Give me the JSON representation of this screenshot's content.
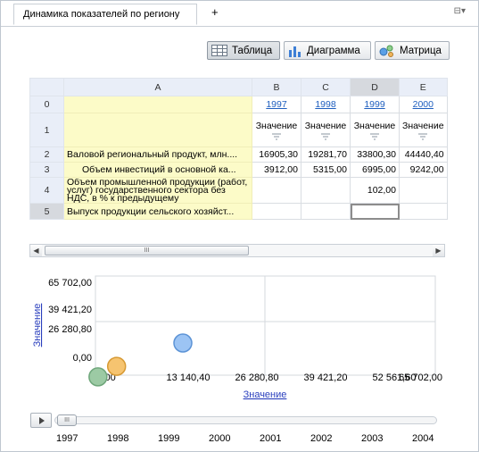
{
  "tabs": {
    "active_label": "Динамика показателей по региону",
    "add_label": "+",
    "menu_label": "⊟▾"
  },
  "toolbar": {
    "table_label": "Таблица",
    "chart_label": "Диаграмма",
    "matrix_label": "Матрица",
    "active": "Таблица"
  },
  "grid": {
    "col_headers": [
      "A",
      "B",
      "C",
      "D",
      "E"
    ],
    "selected_col": "D",
    "row_numbers": [
      "0",
      "1",
      "2",
      "3",
      "4",
      "5"
    ],
    "selected_row": "5",
    "years": [
      "1997",
      "1998",
      "1999",
      "2000"
    ],
    "value_label": "Значение",
    "rows": [
      {
        "label": "Валовой региональный продукт, млн....",
        "values": [
          "16905,30",
          "19281,70",
          "33800,30",
          "44440,40"
        ]
      },
      {
        "label": "Объем инвестиций в основной ка...",
        "values": [
          "3912,00",
          "5315,00",
          "6995,00",
          "9242,00"
        ]
      },
      {
        "label": "Объем промышленной продукции (работ, услуг) государственного сектора без НДС, в % к предыдущему",
        "values": [
          "",
          "",
          "102,00",
          ""
        ]
      },
      {
        "label": "Выпуск продукции сельского хозяйст...",
        "values": [
          "",
          "",
          "",
          ""
        ]
      }
    ]
  },
  "chart_data": {
    "type": "scatter",
    "xlabel": "Значение",
    "ylabel": "Значение",
    "x_ticks": [
      "0,00",
      "13 140,40",
      "26 280,80",
      "39 421,20",
      "52 561,60",
      "65 702,00"
    ],
    "y_ticks": [
      "0,00",
      "26 280,80",
      "39 421,20",
      "65 702,00"
    ],
    "xlim": [
      0,
      65702
    ],
    "ylim": [
      0,
      65702
    ],
    "points": [
      {
        "x": -1800,
        "y": -3500,
        "color": "#9ccaa4"
      },
      {
        "x": 2300,
        "y": -1200,
        "color": "#f6c470"
      },
      {
        "x": 16905.3,
        "y": 3912.0,
        "color": "#9cc4f4"
      }
    ]
  },
  "timeline": {
    "years": [
      "1997",
      "1998",
      "1999",
      "2000",
      "2001",
      "2002",
      "2003",
      "2004"
    ]
  },
  "scroll_grip": "III",
  "colors": {
    "header_bg": "#e9eef8",
    "yellow_cell": "#fcfbc8",
    "link": "#1f5fbf"
  }
}
